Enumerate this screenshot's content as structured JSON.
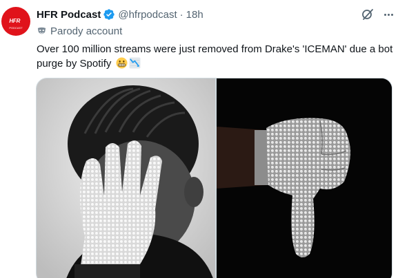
{
  "tweet": {
    "author_name": "HFR Podcast",
    "handle": "@hfrpodcast",
    "separator": "·",
    "timestamp": "18h",
    "label": "Parody account",
    "text": "Over 100 million streams were just removed from Drake's 'ICEMAN' due a bot purge by Spotify",
    "avatar_text": "HFR",
    "avatar_subtext": "PODCAST"
  },
  "icons": {
    "verified": "verified-badge-icon",
    "grok": "grok-icon",
    "more": "more-icon",
    "parody": "parody-mask-icon",
    "emoji_1": "grimacing-face-emoji",
    "emoji_2": "chart-decreasing-emoji"
  },
  "colors": {
    "brand_red": "#e0131b",
    "verified_blue": "#1d9bf0",
    "secondary_text": "#536471",
    "border": "#cfd9de"
  },
  "media": {
    "images": [
      "photo-man-face-palm-glove",
      "photo-glove-thumbs-down"
    ]
  }
}
